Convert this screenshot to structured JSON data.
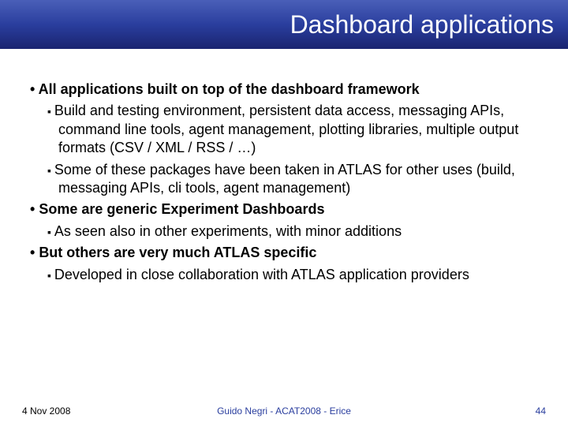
{
  "title": "Dashboard applications",
  "bullets": {
    "b1": "All applications built on top of the dashboard framework",
    "b1_1": "Build and testing environment, persistent data access, messaging APIs, command line tools, agent management, plotting libraries, multiple output formats (CSV / XML / RSS / …)",
    "b1_2": "Some of these packages have been taken in ATLAS for other uses (build, messaging APIs, cli tools, agent management)",
    "b2": "Some are generic Experiment Dashboards",
    "b2_1": "As seen also in other experiments, with minor additions",
    "b3": "But others are very much ATLAS specific",
    "b3_1": "Developed in close collaboration with ATLAS application providers"
  },
  "footer": {
    "date": "4 Nov 2008",
    "center": "Guido Negri - ACAT2008 - Erice",
    "page": "44"
  }
}
